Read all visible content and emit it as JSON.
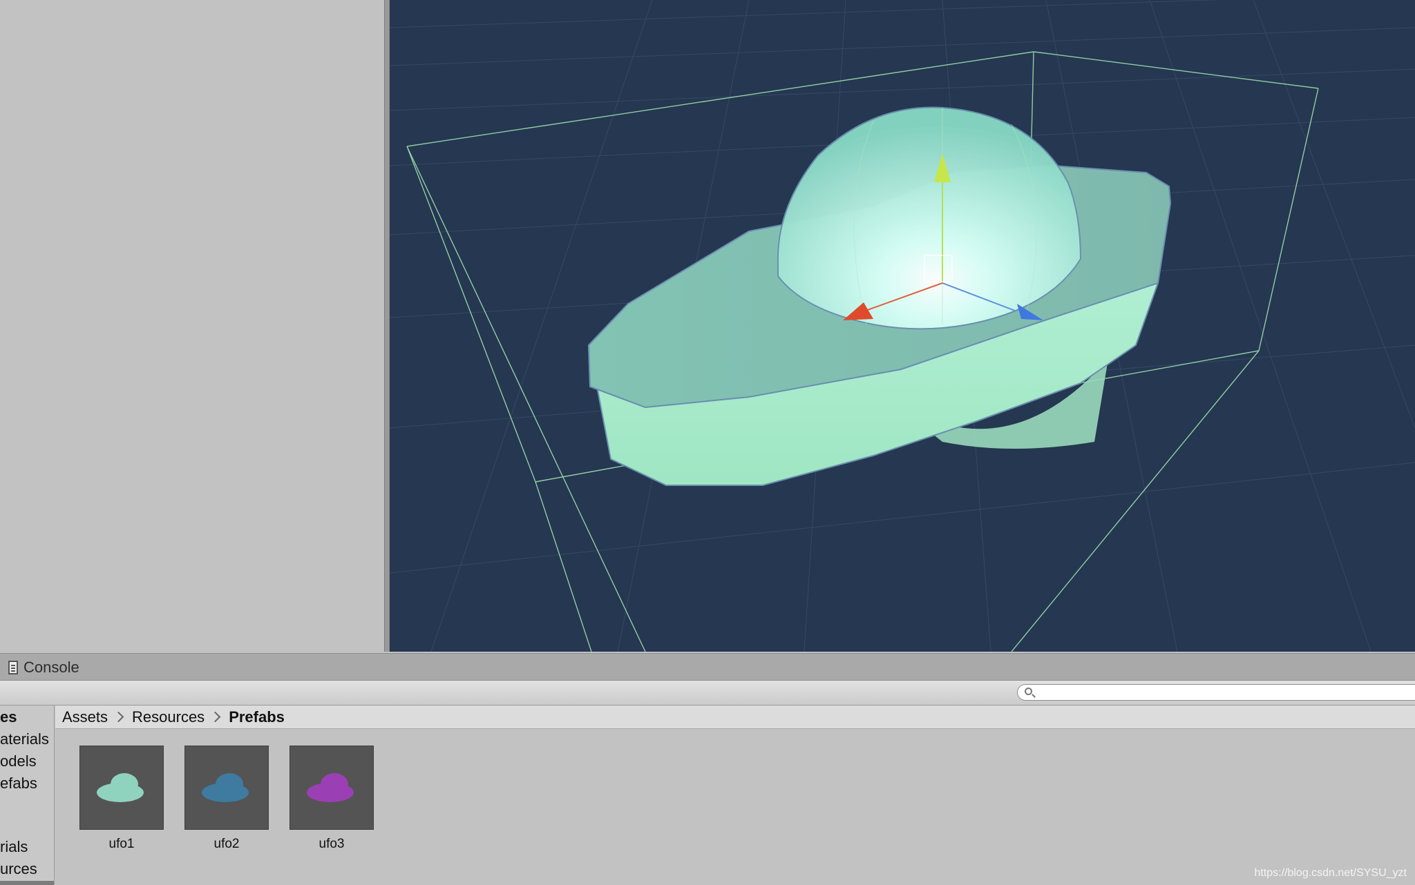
{
  "console": {
    "tab_label": "Console",
    "icon": "console-icon"
  },
  "search": {
    "placeholder": "",
    "icon": "search-icon"
  },
  "folder_tree": {
    "items": [
      "es",
      "aterials",
      "odels",
      "efabs",
      "rials",
      "urces"
    ]
  },
  "breadcrumb": [
    "Assets",
    "Resources",
    "Prefabs"
  ],
  "assets": [
    {
      "name": "ufo1",
      "color": "#8fd3bf"
    },
    {
      "name": "ufo2",
      "color": "#3f7aa0"
    },
    {
      "name": "ufo3",
      "color": "#9b3fb5"
    }
  ],
  "scene": {
    "background": "#253751",
    "selected_object": "ufo",
    "gizmo_axes": [
      "y-axis-handle",
      "x-axis-handle",
      "z-axis-handle"
    ]
  },
  "watermark": "https://blog.csdn.net/SYSU_yzt"
}
